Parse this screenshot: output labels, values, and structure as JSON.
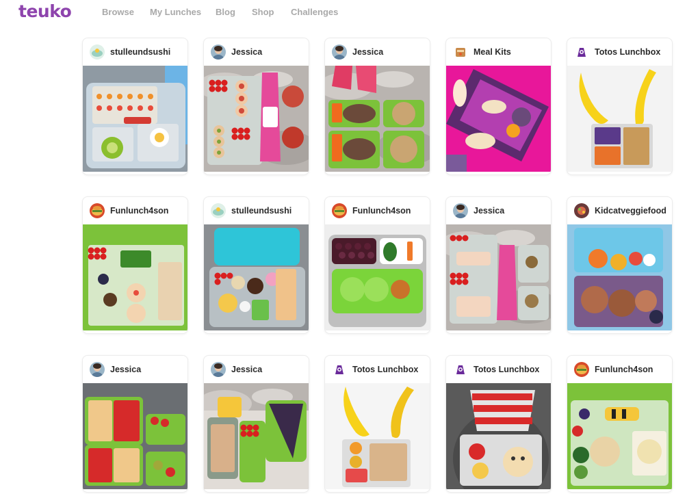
{
  "brand": {
    "logo_text": "teuko",
    "color": "#8e44ad"
  },
  "nav": {
    "items": [
      "Browse",
      "My Lunches",
      "Blog",
      "Shop",
      "Challenges"
    ]
  },
  "cards": [
    {
      "author": "stulleundsushi",
      "avatar": "stulleundsushi",
      "photo": "sushi-bento-blue-lid"
    },
    {
      "author": "Jessica",
      "avatar": "jessica",
      "photo": "pinwheels-kefir-pouch"
    },
    {
      "author": "Jessica",
      "avatar": "jessica",
      "photo": "carrots-meatloaf-applesauce"
    },
    {
      "author": "Meal Kits",
      "avatar": "meal-kits",
      "photo": "wraps-on-pink"
    },
    {
      "author": "Totos Lunchbox",
      "avatar": "totos",
      "photo": "banana-cases-bento"
    },
    {
      "author": "Funlunch4son",
      "avatar": "funlunch",
      "photo": "character-rice-balls"
    },
    {
      "author": "stulleundsushi",
      "avatar": "stulleundsushi",
      "photo": "bento-teal-lid"
    },
    {
      "author": "Funlunch4son",
      "avatar": "funlunch",
      "photo": "frog-rice-balls"
    },
    {
      "author": "Jessica",
      "avatar": "jessica",
      "photo": "wraps-tomatoes-kefir"
    },
    {
      "author": "Kidcatveggiefood",
      "avatar": "kidcat",
      "photo": "donuts-fruit-picks"
    },
    {
      "author": "Jessica",
      "avatar": "jessica",
      "photo": "sandwiches-strawberries"
    },
    {
      "author": "Jessica",
      "avatar": "jessica",
      "photo": "pie-sandwich-pouch"
    },
    {
      "author": "Totos Lunchbox",
      "avatar": "totos",
      "photo": "banana-letter-bento"
    },
    {
      "author": "Totos Lunchbox",
      "avatar": "totos",
      "photo": "cat-in-hat-bento"
    },
    {
      "author": "Funlunch4son",
      "avatar": "funlunch",
      "photo": "bee-honeycomb-bento"
    }
  ]
}
